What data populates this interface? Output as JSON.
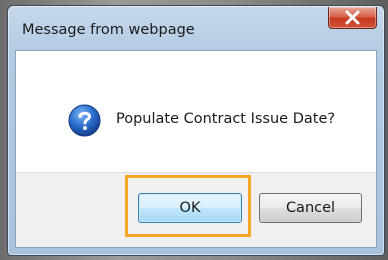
{
  "window": {
    "title": "Message from webpage",
    "close_icon": "close-icon"
  },
  "message": {
    "icon": "question-icon",
    "text": "Populate Contract Issue Date?"
  },
  "buttons": {
    "ok_label": "OK",
    "cancel_label": "Cancel"
  },
  "colors": {
    "highlight": "#f5a623",
    "close_button": "#c4391f",
    "question_icon": "#2a6fd0"
  }
}
